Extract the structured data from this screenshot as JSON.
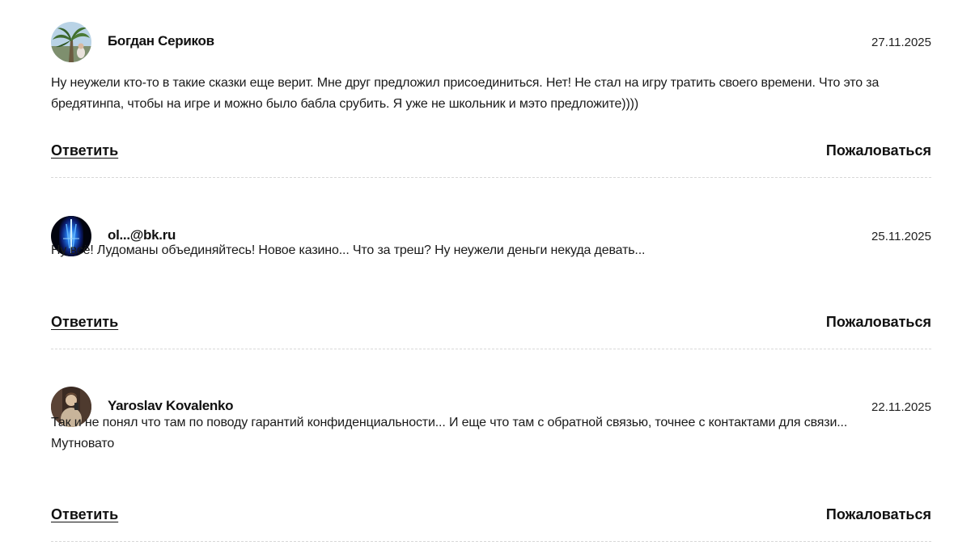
{
  "comments": [
    {
      "author": "Богдан Сериков",
      "date": "27.11.2025",
      "text": "Ну неужели кто-то в такие сказки еще верит. Мне друг предложил присоединиться. Нет! Не стал на игру тратить своего времени. Что это за бредятинпа, чтобы на игре и можно было бабла срубить. Я уже не школьник и мэто предложите))))",
      "reply_label": "Ответить",
      "report_label": "Пожаловаться",
      "avatar_icon": "palm-tree-avatar"
    },
    {
      "author": "ol...@bk.ru",
      "date": "25.11.2025",
      "text": "Ну всё! Лудоманы объединяйтесь! Новое казино... Что за треш? Ну неужели деньги некуда девать...",
      "reply_label": "Ответить",
      "report_label": "Пожаловаться",
      "avatar_icon": "blue-light-avatar"
    },
    {
      "author": "Yaroslav Kovalenko",
      "date": "22.11.2025",
      "text": "Так и не понял что там по поводу гарантий конфиденциальности... И еще что там с обратной связью, точнее с контактами для связи... Мутновато",
      "reply_label": "Ответить",
      "report_label": "Пожаловаться",
      "avatar_icon": "person-photo-avatar"
    }
  ],
  "colors": {
    "text": "#111111",
    "divider": "#d8d8d8",
    "background": "#ffffff"
  }
}
